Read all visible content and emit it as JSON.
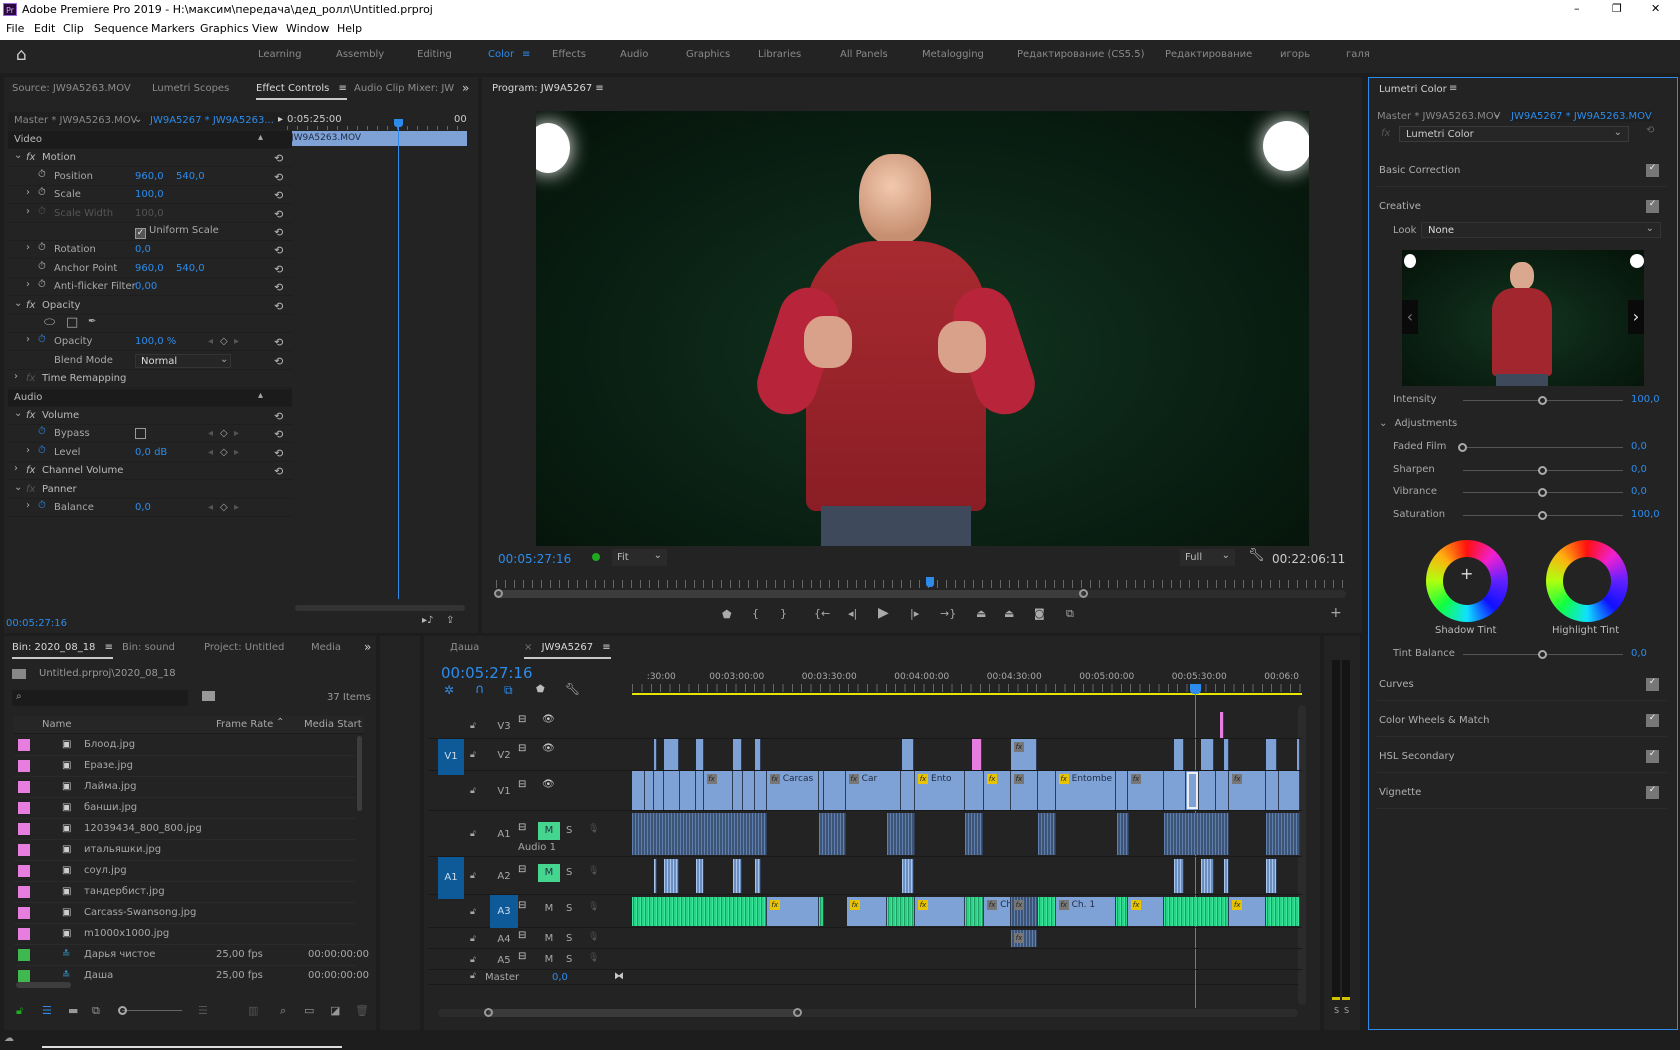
{
  "window": {
    "title": "Adobe Premiere Pro 2019 - H:\\максим\\передача\\дед_ролл\\Untitled.prproj",
    "app_icon": "Pr",
    "controls": [
      "–",
      "❐",
      "✕"
    ]
  },
  "menu": [
    "File",
    "Edit",
    "Clip",
    "Sequence",
    "Markers",
    "Graphics",
    "View",
    "Window",
    "Help"
  ],
  "workspaces": {
    "active": "Color",
    "items": [
      "Learning",
      "Assembly",
      "Editing",
      "Color",
      "Effects",
      "Audio",
      "Graphics",
      "Libraries",
      "All Panels",
      "Metalogging",
      "Редактирование (CS5.5)",
      "Редактирование",
      "игорь",
      "галя"
    ]
  },
  "source_panel": {
    "tabs": [
      "Source: JW9A5263.MOV",
      "Lumetri Scopes",
      "Effect Controls",
      "Audio Clip Mixer: JW"
    ],
    "active_tab": "Effect Controls",
    "master_clip": "Master * JW9A5263.MOV",
    "sequence_clip": "JW9A5267 * JW9A5263...",
    "ruler_time": "0:05:25:00",
    "ruler_end": "00",
    "clip_bar": "JW9A5263.MOV",
    "rows": [
      {
        "type": "section",
        "label": "Video"
      },
      {
        "type": "effect",
        "label": "Motion",
        "expanded": true
      },
      {
        "type": "param",
        "label": "Position",
        "v1": "960,0",
        "v2": "540,0"
      },
      {
        "type": "param",
        "label": "Scale",
        "v1": "100,0",
        "expand": true
      },
      {
        "type": "param",
        "label": "Scale Width",
        "v1": "100,0",
        "expand": true,
        "disabled": true
      },
      {
        "type": "check",
        "label": "Uniform Scale",
        "checked": true
      },
      {
        "type": "param",
        "label": "Rotation",
        "v1": "0,0",
        "expand": true
      },
      {
        "type": "param",
        "label": "Anchor Point",
        "v1": "960,0",
        "v2": "540,0"
      },
      {
        "type": "param",
        "label": "Anti-flicker Filter",
        "v1": "0,00",
        "expand": true
      },
      {
        "type": "effect",
        "label": "Opacity",
        "expanded": true
      },
      {
        "type": "masks"
      },
      {
        "type": "param",
        "label": "Opacity",
        "v1": "100,0 %",
        "expand": true,
        "animated": true,
        "keyframes": true
      },
      {
        "type": "select",
        "label": "Blend Mode",
        "value": "Normal"
      },
      {
        "type": "effect",
        "label": "Time Remapping",
        "expanded": false,
        "fxoff": true,
        "noreset": true
      },
      {
        "type": "section",
        "label": "Audio"
      },
      {
        "type": "effect",
        "label": "Volume",
        "expanded": true
      },
      {
        "type": "box",
        "label": "Bypass",
        "animated": true,
        "keyframes": true
      },
      {
        "type": "param",
        "label": "Level",
        "v1": "0,0 dB",
        "expand": true,
        "animated": true,
        "keyframes": true
      },
      {
        "type": "effect",
        "label": "Channel Volume",
        "expanded": false
      },
      {
        "type": "effect",
        "label": "Panner",
        "expanded": true,
        "fxoff": true,
        "noreset": true
      },
      {
        "type": "param",
        "label": "Balance",
        "v1": "0,0",
        "expand": true,
        "animated": true,
        "keyframes": true,
        "noreset": true
      }
    ],
    "timecode": "00:05:27:16"
  },
  "program": {
    "title": "Program: JW9A5267",
    "timecode": "00:05:27:16",
    "fit": "Fit",
    "quality": "Full",
    "duration": "00:22:06:11",
    "playhead_fraction": 0.51
  },
  "lumetri": {
    "title": "Lumetri Color",
    "master_clip": "Master * JW9A5263.MOV",
    "sequence_clip": "JW9A5267 * JW9A5263.MOV",
    "effect": "Lumetri Color",
    "basic_correction": "Basic Correction",
    "creative": "Creative",
    "look_label": "Look",
    "look_value": "None",
    "intensity": {
      "label": "Intensity",
      "value": "100,0",
      "fraction": 0.5
    },
    "adjustments": "Adjustments",
    "sliders": [
      {
        "label": "Faded Film",
        "value": "0,0",
        "fraction": 0
      },
      {
        "label": "Sharpen",
        "value": "0,0",
        "fraction": 0.5
      },
      {
        "label": "Vibrance",
        "value": "0,0",
        "fraction": 0.5
      },
      {
        "label": "Saturation",
        "value": "100,0",
        "fraction": 0.5
      }
    ],
    "shadow_tint": "Shadow Tint",
    "highlight_tint": "Highlight Tint",
    "tint_balance": {
      "label": "Tint Balance",
      "value": "0,0",
      "fraction": 0.5
    },
    "sections": [
      "Curves",
      "Color Wheels & Match",
      "HSL Secondary",
      "Vignette"
    ]
  },
  "project": {
    "tabs": [
      "Bin: 2020_08_18",
      "Bin: sound",
      "Project: Untitled",
      "Media"
    ],
    "path": "Untitled.prproj\\2020_08_18",
    "search_placeholder": "",
    "count": "37 Items",
    "columns": [
      "Name",
      "Frame Rate",
      "Media Start"
    ],
    "items": [
      {
        "name": "Блоод.jpg",
        "color": "#e87de0",
        "kind": "image",
        "fps": "",
        "start": ""
      },
      {
        "name": "Еразе.jpg",
        "color": "#e87de0",
        "kind": "image",
        "fps": "",
        "start": ""
      },
      {
        "name": "Лайма.jpg",
        "color": "#e87de0",
        "kind": "image",
        "fps": "",
        "start": ""
      },
      {
        "name": "банши.jpg",
        "color": "#e87de0",
        "kind": "image",
        "fps": "",
        "start": ""
      },
      {
        "name": "12039434_800_800.jpg",
        "color": "#e87de0",
        "kind": "image",
        "fps": "",
        "start": ""
      },
      {
        "name": "итальяшки.jpg",
        "color": "#e87de0",
        "kind": "image",
        "fps": "",
        "start": ""
      },
      {
        "name": "соул.jpg",
        "color": "#e87de0",
        "kind": "image",
        "fps": "",
        "start": ""
      },
      {
        "name": "тандербист.jpg",
        "color": "#e87de0",
        "kind": "image",
        "fps": "",
        "start": ""
      },
      {
        "name": "Carcass-Swansong.jpg",
        "color": "#e87de0",
        "kind": "image",
        "fps": "",
        "start": ""
      },
      {
        "name": "m1000x1000.jpg",
        "color": "#e87de0",
        "kind": "image",
        "fps": "",
        "start": ""
      },
      {
        "name": "Дарья чистое",
        "color": "#3fb84f",
        "kind": "sequence",
        "fps": "25,00 fps",
        "start": "00:00:00:00"
      },
      {
        "name": "Даша",
        "color": "#3fb84f",
        "kind": "sequence",
        "fps": "25,00 fps",
        "start": "00:00:00:00"
      }
    ]
  },
  "timeline": {
    "tabs": [
      "Даша",
      "JW9A5267"
    ],
    "active_tab": "JW9A5267",
    "timecode": "00:05:27:16",
    "ruler_labels": [
      {
        "t": 150,
        "label": ":30:00"
      },
      {
        "t": 180,
        "label": "00:03:00:00"
      },
      {
        "t": 210,
        "label": "00:03:30:00"
      },
      {
        "t": 240,
        "label": "00:04:00:00"
      },
      {
        "t": 270,
        "label": "00:04:30:00"
      },
      {
        "t": 300,
        "label": "00:05:00:00"
      },
      {
        "t": 330,
        "label": "00:05:30:00"
      },
      {
        "t": 360,
        "label": "00:06:0"
      }
    ],
    "view_start_s": 145.2,
    "view_end_s": 362.5,
    "playhead_s": 327.64,
    "tracks": [
      {
        "id": "V3",
        "kind": "video"
      },
      {
        "id": "V2",
        "kind": "video",
        "source": "V1"
      },
      {
        "id": "V1",
        "kind": "video"
      },
      {
        "id": "A1",
        "kind": "audio",
        "name": "Audio 1",
        "mute": true
      },
      {
        "id": "A2",
        "kind": "audio",
        "source": "A1",
        "mute": true
      },
      {
        "id": "A3",
        "kind": "audio",
        "targeted": true
      },
      {
        "id": "A4",
        "kind": "audio"
      },
      {
        "id": "A5",
        "kind": "audio"
      }
    ],
    "master": {
      "label": "Master",
      "value": "0,0"
    },
    "clips": {
      "V3": [
        [
          336,
          337.2,
          "pink"
        ]
      ],
      "V2": [
        [
          152.3,
          153.4
        ],
        [
          155.5,
          160.4
        ],
        [
          165.8,
          168.4
        ],
        [
          177.9,
          180.8
        ],
        [
          185,
          187.2
        ],
        [
          232.7,
          236.7
        ],
        [
          255.5,
          258.8,
          "pink"
        ],
        [
          268.1,
          276.6,
          "blue",
          "fx"
        ],
        [
          321.1,
          324.2
        ],
        [
          329.6,
          333.9
        ],
        [
          337.2,
          338.9
        ],
        [
          350.7,
          354.5
        ],
        [
          361,
          361.7
        ]
      ],
      "V1": [
        [
          145.2,
          149.4
        ],
        [
          149.4,
          152.3
        ],
        [
          152.3,
          155.5
        ],
        [
          155.5,
          160.8
        ],
        [
          160.8,
          165.8
        ],
        [
          165.8,
          168.4
        ],
        [
          168.4,
          177.9,
          "blue",
          "fx"
        ],
        [
          177.9,
          181.2
        ],
        [
          181.2,
          185
        ],
        [
          185,
          188.9
        ],
        [
          188.9,
          205.7,
          "blue",
          "fx",
          "Carcas"
        ],
        [
          205.7,
          207.5
        ],
        [
          207.5,
          214.5
        ],
        [
          214.5,
          232.3,
          "blue",
          "fx",
          "Car"
        ],
        [
          232.3,
          237
        ],
        [
          237,
          253.1,
          "blue",
          "fxy",
          "Ento"
        ],
        [
          253.1,
          259.4
        ],
        [
          259.4,
          268.1,
          "blue",
          "fxy"
        ],
        [
          268.1,
          276.9,
          "blue",
          "fx"
        ],
        [
          276.9,
          282.6
        ],
        [
          282.6,
          302.1,
          "blue",
          "fxy",
          "Entombe"
        ],
        [
          302.1,
          306.1
        ],
        [
          306.1,
          317.6,
          "blue",
          "fx"
        ],
        [
          317.6,
          324.9
        ],
        [
          324.9,
          329.2,
          "sel"
        ],
        [
          329.2,
          334.6
        ],
        [
          334.6,
          338.9
        ],
        [
          338.9,
          350.7,
          "blue",
          "fx"
        ],
        [
          350.7,
          355
        ],
        [
          355,
          361.7
        ]
      ],
      "A1": [
        [
          145.2,
          188.9,
          "dblue"
        ],
        [
          205.7,
          214.5,
          "dblue"
        ],
        [
          228,
          237,
          "dblue"
        ],
        [
          253.1,
          259,
          "dblue"
        ],
        [
          276.9,
          282.6,
          "dblue"
        ],
        [
          302.5,
          306.4,
          "dblue"
        ],
        [
          317.6,
          338.9,
          "dblue"
        ],
        [
          350.7,
          361.7,
          "dblue"
        ]
      ],
      "A2": [
        [
          152.3,
          153.4,
          "wblue"
        ],
        [
          155.5,
          160.4,
          "wblue"
        ],
        [
          165.8,
          168.4,
          "wblue"
        ],
        [
          177.9,
          180.8,
          "wblue"
        ],
        [
          185,
          187.2,
          "wblue"
        ],
        [
          232.7,
          236.7,
          "wblue"
        ],
        [
          321.1,
          324.2,
          "wblue"
        ],
        [
          329.6,
          333.9,
          "wblue"
        ],
        [
          337.2,
          338.9,
          "wblue"
        ],
        [
          350.7,
          354.5,
          "wblue"
        ]
      ],
      "A3": [
        [
          145.2,
          188.9,
          "green"
        ],
        [
          188.9,
          205.7,
          "blue",
          "fxy"
        ],
        [
          205.7,
          207.5,
          "green"
        ],
        [
          214.9,
          228,
          "blue",
          "fxy"
        ],
        [
          228,
          237,
          "green"
        ],
        [
          237,
          253.1,
          "blue",
          "fxy"
        ],
        [
          253.1,
          259.4,
          "green"
        ],
        [
          259.4,
          268.1,
          "blue",
          "fx",
          "Ch. 1"
        ],
        [
          268.1,
          276.9,
          "dblue",
          "fx"
        ],
        [
          276.9,
          282.6,
          "green"
        ],
        [
          282.6,
          302.1,
          "blue",
          "fx",
          "Ch. 1"
        ],
        [
          302.1,
          306.1,
          "green"
        ],
        [
          306.1,
          317.6,
          "blue",
          "fxy"
        ],
        [
          317.6,
          338.9,
          "green"
        ],
        [
          338.9,
          350.7,
          "blue",
          "fxy"
        ],
        [
          350.7,
          361.7,
          "green"
        ]
      ],
      "A4": [
        [
          268.1,
          276.6,
          "dblue",
          "fx"
        ]
      ],
      "A5": []
    }
  },
  "meters": {
    "labels": [
      "S",
      "S"
    ]
  },
  "colors": {
    "accent": "#2d8ceb",
    "clip_video": "#7ea2d6",
    "clip_audio_green": "#2fd08a",
    "label_pink": "#e87de0",
    "mute_on": "#46d58e",
    "work_area": "#e6e600"
  }
}
